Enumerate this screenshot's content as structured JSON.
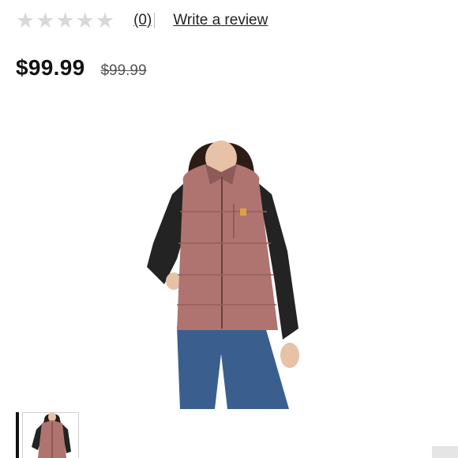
{
  "rating": {
    "stars": [
      "★",
      "★",
      "★",
      "★",
      "★"
    ],
    "stars_filled": 0,
    "review_count": "(0)",
    "write_review": "Write a review",
    "star_color": "#d8d8d8"
  },
  "price": {
    "current": "$99.99",
    "original": "$99.99"
  },
  "product": {
    "colors": {
      "vest": "#b07470",
      "vest_dark": "#8f5b58",
      "sleeves": "#232323",
      "jeans": "#3a5f8f",
      "skin": "#e7c2a6",
      "hair": "#2b1d16"
    }
  },
  "thumbnails": [
    {
      "selected": true
    }
  ]
}
